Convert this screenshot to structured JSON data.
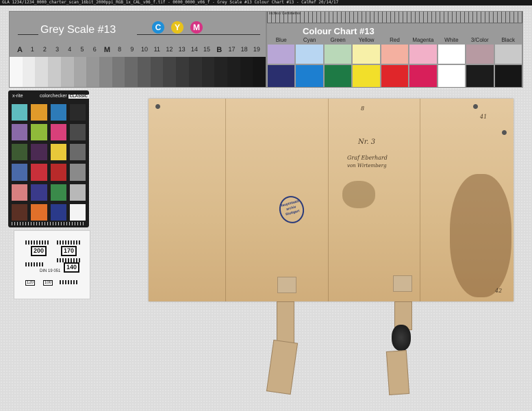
{
  "header_text": "GLA 1234/1234_0000_charter_scan_16bit_2000ppi_RGB_1x_CAL_v06_f.tif  - 0000_0000_v06_f - Grey Scale #13 Colour Chart #13 - CalRef 20/14/17",
  "grey_scale": {
    "title": "Grey Scale #13",
    "cym": [
      {
        "letter": "C",
        "color": "#1f8fd8"
      },
      {
        "letter": "Y",
        "color": "#e8c21a"
      },
      {
        "letter": "M",
        "color": "#d63384"
      }
    ],
    "numbers": [
      "A",
      "1",
      "2",
      "3",
      "4",
      "5",
      "6",
      "M",
      "8",
      "9",
      "10",
      "11",
      "12",
      "13",
      "14",
      "15",
      "B",
      "17",
      "18",
      "19"
    ],
    "patches": [
      "#f7f7f7",
      "#ececec",
      "#dcdcdc",
      "#cacaca",
      "#b8b8b8",
      "#a7a7a7",
      "#979797",
      "#878787",
      "#787878",
      "#6a6a6a",
      "#5c5c5c",
      "#4f4f4f",
      "#444444",
      "#3a3a3a",
      "#313131",
      "#2a2a2a",
      "#232323",
      "#1e1e1e",
      "#191919",
      "#151515"
    ]
  },
  "colour_chart": {
    "title": "Colour Chart #13",
    "ruler_label": "Inches / Centimetres",
    "labels": [
      "Blue",
      "Cyan",
      "Green",
      "Yellow",
      "Red",
      "Magenta",
      "White",
      "3/Color",
      "Black"
    ],
    "top_colors": [
      "#b8a6d6",
      "#b8d6f2",
      "#b9d8b8",
      "#f7f0a8",
      "#f4b0a0",
      "#f2b0c8",
      "#ffffff",
      "#b79aa2",
      "#c9c9c9"
    ],
    "bottom_colors": [
      "#2a2f6e",
      "#1d7fd0",
      "#1e7a45",
      "#f2df2a",
      "#e0262a",
      "#d81f5a",
      "#ffffff",
      "#1c1c1c",
      "#161616"
    ]
  },
  "checker": {
    "brand": "x-rite",
    "product": "colorchecker",
    "edition": "CLASSIC",
    "swatches": [
      "#5fbcbf",
      "#e09a2a",
      "#2d7bb8",
      "#2a2a2a",
      "#8a6aa8",
      "#8fba3a",
      "#d8407a",
      "#4a4a4a",
      "#3d5a32",
      "#4b2a52",
      "#e8c83a",
      "#6a6a6a",
      "#4a6aa8",
      "#c8303a",
      "#b82a2a",
      "#8a8a8a",
      "#d88080",
      "#3a3a8a",
      "#3a8a4a",
      "#b8b8b8",
      "#5a3024",
      "#e0702a",
      "#2a3a8a",
      "#f4f4f4"
    ]
  },
  "din": {
    "label": "DIN 19 051",
    "values": [
      "200",
      "170",
      "140",
      "120",
      "100"
    ]
  },
  "charter": {
    "dorsal_note_1": "Nr. 3",
    "dorsal_note_2": "Graf Eberhard",
    "dorsal_note_3": "von Wirtemberg",
    "top_mark": "8",
    "right_mark": "41",
    "corner_mark": "42",
    "stamp_text": [
      "Hauptstaats-",
      "archiv",
      "Stuttgart"
    ]
  }
}
